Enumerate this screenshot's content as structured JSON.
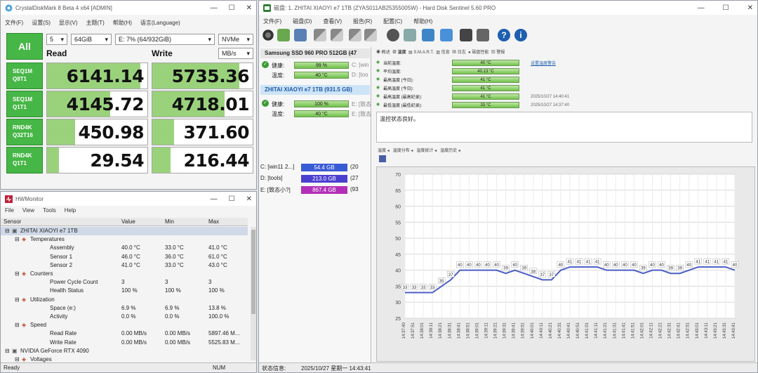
{
  "cdm": {
    "title": "CrystalDiskMark 8 Beta 4 x64 [ADMIN]",
    "menu": [
      "文件(F)",
      "设置(S)",
      "显示(V)",
      "主题(T)",
      "帮助(H)",
      "语言(Language)"
    ],
    "all_label": "All",
    "runs": "5",
    "size": "64GiB",
    "drive": "E: 7% (64/932GiB)",
    "mode": "NVMe",
    "unit": "MB/s",
    "read_header": "Read",
    "write_header": "Write",
    "rows": [
      {
        "l1": "SEQ1M",
        "l2": "Q8T1",
        "read": "6141.14",
        "write": "5735.36",
        "rfill": 0.93,
        "wfill": 0.87
      },
      {
        "l1": "SEQ1M",
        "l2": "Q1T1",
        "read": "4145.72",
        "write": "4718.01",
        "rfill": 0.63,
        "wfill": 0.72
      },
      {
        "l1": "RND4K",
        "l2": "Q32T16",
        "read": "450.98",
        "write": "371.60",
        "rfill": 0.28,
        "wfill": 0.22
      },
      {
        "l1": "RND4K",
        "l2": "Q1T1",
        "read": "29.54",
        "write": "216.44",
        "rfill": 0.12,
        "wfill": 0.18
      }
    ]
  },
  "hwm": {
    "title": "HWMonitor",
    "menu": [
      "File",
      "View",
      "Tools",
      "Help"
    ],
    "headers": [
      "Sensor",
      "Value",
      "Min",
      "Max"
    ],
    "rows": [
      {
        "name": "ZHITAI XIAOYI e7 1TB",
        "value": "",
        "min": "",
        "max": "",
        "indent": 1
      },
      {
        "name": "Temperatures",
        "value": "",
        "min": "",
        "max": "",
        "indent": 2
      },
      {
        "name": "Assembly",
        "value": "40.0 °C",
        "min": "33.0 °C",
        "max": "41.0 °C",
        "indent": 3
      },
      {
        "name": "Sensor 1",
        "value": "46.0 °C",
        "min": "36.0 °C",
        "max": "61.0 °C",
        "indent": 3
      },
      {
        "name": "Sensor 2",
        "value": "41.0 °C",
        "min": "33.0 °C",
        "max": "43.0 °C",
        "indent": 3
      },
      {
        "name": "Counters",
        "value": "",
        "min": "",
        "max": "",
        "indent": 2
      },
      {
        "name": "Power Cycle Count",
        "value": "3",
        "min": "3",
        "max": "3",
        "indent": 3
      },
      {
        "name": "Health Status",
        "value": "100 %",
        "min": "100 %",
        "max": "100 %",
        "indent": 3
      },
      {
        "name": "Utilization",
        "value": "",
        "min": "",
        "max": "",
        "indent": 2
      },
      {
        "name": "Space (e:)",
        "value": "6.9 %",
        "min": "6.9 %",
        "max": "13.8 %",
        "indent": 3
      },
      {
        "name": "Activity",
        "value": "0.0 %",
        "min": "0.0 %",
        "max": "100.0 %",
        "indent": 3
      },
      {
        "name": "Speed",
        "value": "",
        "min": "",
        "max": "",
        "indent": 2
      },
      {
        "name": "Read Rate",
        "value": "0.00 MB/s",
        "min": "0.00 MB/s",
        "max": "5897.46 M...",
        "indent": 3
      },
      {
        "name": "Write Rate",
        "value": "0.00 MB/s",
        "min": "0.00 MB/s",
        "max": "5525.83 M...",
        "indent": 3
      },
      {
        "name": "NVIDIA GeForce RTX 4090",
        "value": "",
        "min": "",
        "max": "",
        "indent": 1
      },
      {
        "name": "Voltages",
        "value": "",
        "min": "",
        "max": "",
        "indent": 2
      }
    ],
    "status_left": "Ready",
    "status_right": "NUM"
  },
  "hds": {
    "title": "磁盘:   1. ZHITAI XIAOYI e7 1TB (ZYAS011AB25355005W) - Hard Disk Sentinel 5.60 PRO",
    "menu": [
      "文件(F)",
      "磁盘(D)",
      "查看(V)",
      "报告(R)",
      "配置(C)",
      "帮助(H)"
    ],
    "disks": [
      {
        "name": "Samsung SSD 960 PRO 512GB (47",
        "health_label": "健康:",
        "health": "99 %",
        "temp_label": "温度:",
        "temp": "40 °C",
        "vol_a": "C: [win",
        "vol_b": "D: [too"
      },
      {
        "name": "ZHITAI XIAOYI e7 1TB (931.5 GB)",
        "health_label": "健康:",
        "health": "100 %",
        "temp_label": "温度:",
        "temp": "40 °C",
        "vol_a": "E: [致态",
        "vol_b": "E: [致态"
      }
    ],
    "volumes": [
      {
        "label": "C: [win11 2...]",
        "size": "54.4 GB",
        "rest": "(20",
        "color": "#3a5bd6"
      },
      {
        "label": "D: [tools]",
        "size": "213.0 GB",
        "rest": "(27",
        "color": "#4b3fd0"
      },
      {
        "label": "E: [致态小?]",
        "size": "867.4 GB",
        "rest": "(93",
        "color": "#b22fb8"
      }
    ],
    "temp_rows": [
      {
        "label": "当前温度:",
        "value": "40 °C"
      },
      {
        "label": "平均温度:",
        "value": "40.13 °C"
      },
      {
        "label": "最高温度 (今日):",
        "value": "41 °C"
      },
      {
        "label": "最高温度 (今日):",
        "value": "41 °C"
      },
      {
        "label": "最高温度 (最高纪录):",
        "value": "41 °C"
      },
      {
        "label": "最低温度 (最低纪录):",
        "value": "33 °C"
      }
    ],
    "dates": [
      "2025/10/27  14:40:41",
      "2025/10/27  14:37:40"
    ],
    "link": "设置温度警告",
    "note": "温控状态良好。",
    "chart_tabs": [
      "温度",
      "温度分布",
      "温度统计",
      "温度历史"
    ],
    "status_left": "状态信息:",
    "status_time": "2025/10/27 星期一 14:43:41"
  },
  "chart_data": {
    "type": "line",
    "title": "",
    "xlabel": "",
    "ylabel": "",
    "ylim": [
      25,
      70
    ],
    "yticks": [
      25,
      30,
      35,
      40,
      45,
      50,
      55,
      60,
      65,
      70
    ],
    "x": [
      "14:37:40",
      "14:37:51",
      "14:38:01",
      "14:38:11",
      "14:38:21",
      "14:38:31",
      "14:38:41",
      "14:38:51",
      "14:39:01",
      "14:39:11",
      "14:39:21",
      "14:39:31",
      "14:39:41",
      "14:39:51",
      "14:40:01",
      "14:40:11",
      "14:40:21",
      "14:40:31",
      "14:40:41",
      "14:40:51",
      "14:41:01",
      "14:41:11",
      "14:41:21",
      "14:41:31",
      "14:41:41",
      "14:41:51",
      "14:42:01",
      "14:42:11",
      "14:42:21",
      "14:42:31",
      "14:42:41",
      "14:42:51",
      "14:43:01",
      "14:43:11",
      "14:43:21",
      "14:43:31",
      "14:43:41"
    ],
    "values": [
      33,
      33,
      33,
      33,
      35,
      37,
      40,
      40,
      40,
      40,
      40,
      39,
      40,
      39,
      38,
      37,
      37,
      40,
      41,
      41,
      41,
      41,
      40,
      40,
      40,
      40,
      39,
      40,
      40,
      39,
      39,
      40,
      41,
      41,
      41,
      41,
      40
    ]
  }
}
